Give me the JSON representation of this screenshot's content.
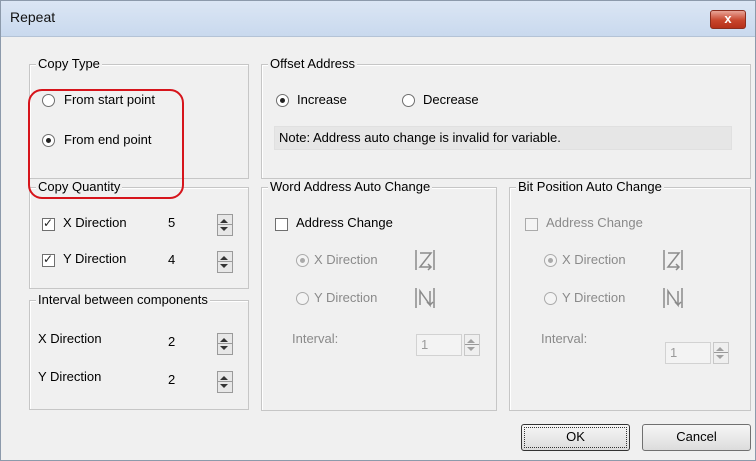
{
  "window": {
    "title": "Repeat",
    "close_glyph": "x"
  },
  "copy_type": {
    "legend": "Copy Type",
    "options": [
      {
        "label": "From start point",
        "selected": false
      },
      {
        "label": "From end point",
        "selected": true
      }
    ]
  },
  "offset_address": {
    "legend": "Offset Address",
    "options": [
      {
        "label": "Increase",
        "selected": true
      },
      {
        "label": "Decrease",
        "selected": false
      }
    ],
    "note": "Note: Address auto change is invalid for variable."
  },
  "copy_quantity": {
    "legend": "Copy Quantity",
    "x": {
      "label": "X Direction",
      "checked": true,
      "value": "5"
    },
    "y": {
      "label": "Y Direction",
      "checked": true,
      "value": "4"
    }
  },
  "interval": {
    "legend": "Interval between components",
    "x": {
      "label": "X Direction",
      "value": "2"
    },
    "y": {
      "label": "Y Direction",
      "value": "2"
    }
  },
  "word_address": {
    "legend": "Word Address Auto Change",
    "checkbox_label": "Address Change",
    "x_label": "X Direction",
    "y_label": "Y Direction",
    "interval_label": "Interval:",
    "interval_value": "1"
  },
  "bit_position": {
    "legend": "Bit Position Auto Change",
    "checkbox_label": "Address Change",
    "x_label": "X Direction",
    "y_label": "Y Direction",
    "interval_label": "Interval:",
    "interval_value": "1"
  },
  "buttons": {
    "ok": "OK",
    "cancel": "Cancel"
  },
  "icons": {
    "z_order": "z-scan-direction-icon",
    "n_order": "n-scan-direction-icon"
  },
  "colors": {
    "highlight": "#d6141b",
    "close": "#c8452c"
  }
}
